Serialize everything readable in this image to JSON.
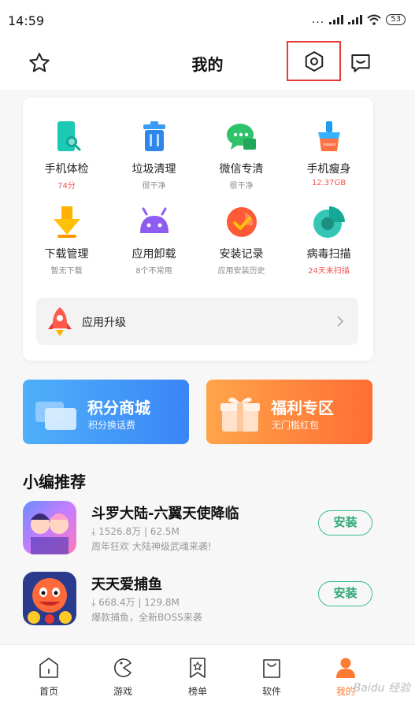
{
  "status": {
    "time": "14:59",
    "dots": "...",
    "battery": "53"
  },
  "header": {
    "title": "我的"
  },
  "tools": [
    {
      "name": "手机体检",
      "sub": "74分",
      "alert": true
    },
    {
      "name": "垃圾清理",
      "sub": "很干净",
      "alert": false
    },
    {
      "name": "微信专清",
      "sub": "很干净",
      "alert": false
    },
    {
      "name": "手机瘦身",
      "sub": "12.37GB",
      "alert": true
    },
    {
      "name": "下载管理",
      "sub": "暂无下载",
      "alert": false
    },
    {
      "name": "应用卸载",
      "sub": "8个不常用",
      "alert": false
    },
    {
      "name": "安装记录",
      "sub": "应用安装历史",
      "alert": false
    },
    {
      "name": "病毒扫描",
      "sub": "24天未扫描",
      "alert": true
    }
  ],
  "upgrade": {
    "label": "应用升级"
  },
  "promos": [
    {
      "title": "积分商城",
      "sub": "积分换话费"
    },
    {
      "title": "福利专区",
      "sub": "无门槛红包"
    }
  ],
  "recommend": {
    "title": "小编推荐",
    "apps": [
      {
        "name": "斗罗大陆-六翼天使降临",
        "downloads": "⤓ 1526.8万",
        "size": "62.5M",
        "desc": "周年狂欢 大陆神级武魂来袭!",
        "install": "安装"
      },
      {
        "name": "天天爱捕鱼",
        "downloads": "⤓ 668.4万",
        "size": "129.8M",
        "desc": "爆款捕鱼，全新BOSS来袭",
        "install": "安装"
      }
    ]
  },
  "nav": [
    {
      "label": "首页"
    },
    {
      "label": "游戏"
    },
    {
      "label": "榜单"
    },
    {
      "label": "软件"
    },
    {
      "label": "我的"
    }
  ],
  "watermark": "Baidu 经验",
  "colors": {
    "accent_green": "#3cbf8c",
    "alert_red": "#ef5350",
    "active_orange": "#ff7a32",
    "promo_blue": "#3a85f5",
    "promo_orange": "#ff6e34"
  }
}
